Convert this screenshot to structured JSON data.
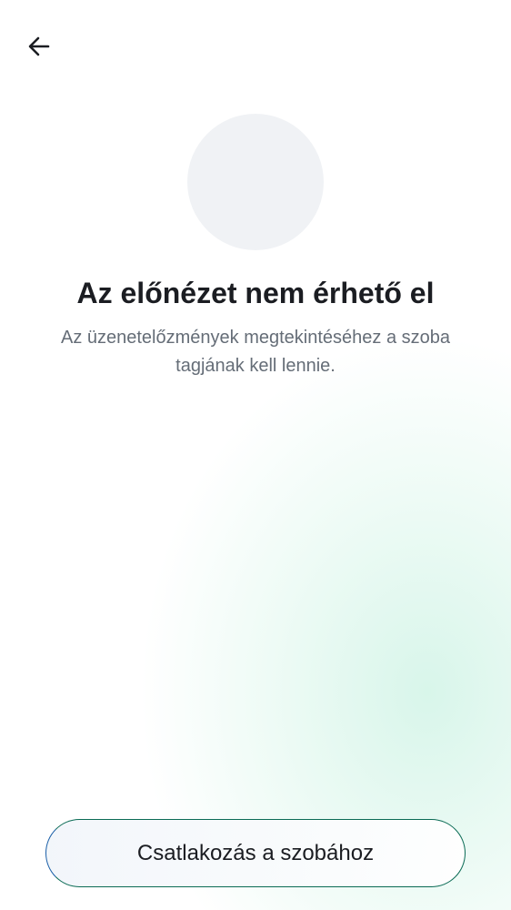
{
  "header": {
    "back_icon": "arrow-left-icon"
  },
  "preview": {
    "title": "Az előnézet nem érhető el",
    "message": "Az üzenetelőzmények megtekintéséhez a szoba tagjának kell lennie."
  },
  "actions": {
    "join_label": "Csatlakozás a szobához"
  },
  "colors": {
    "title_text": "#1b1d22",
    "secondary_text": "#656d77",
    "avatar_placeholder": "#f0f2f5",
    "accent_green": "#0b6b55",
    "gradient_tint": "#d6f5e9"
  }
}
